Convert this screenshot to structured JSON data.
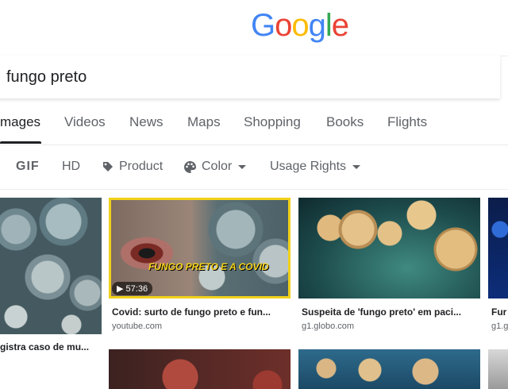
{
  "header": {
    "logo_letters": [
      {
        "ch": "G",
        "color": "#4285F4"
      },
      {
        "ch": "o",
        "color": "#EA4335"
      },
      {
        "ch": "o",
        "color": "#FBBC05"
      },
      {
        "ch": "g",
        "color": "#4285F4"
      },
      {
        "ch": "l",
        "color": "#34A853"
      },
      {
        "ch": "e",
        "color": "#EA4335"
      }
    ]
  },
  "search": {
    "value": "fungo preto"
  },
  "tabs": {
    "images": "mages",
    "videos": "Videos",
    "news": "News",
    "maps": "Maps",
    "shopping": "Shopping",
    "books": "Books",
    "flights": "Flights",
    "active": "images"
  },
  "filters": {
    "gif": "GIF",
    "hd": "HD",
    "product": "Product",
    "color": "Color",
    "usage_rights": "Usage Rights"
  },
  "results": [
    {
      "title": "gistra caso de mu...",
      "source": ""
    },
    {
      "title": "Covid: surto de fungo preto e fun...",
      "source": "youtube.com",
      "duration": "57:36",
      "overlay": "FUNGO PRETO E A COVID"
    },
    {
      "title": "Suspeita de 'fungo preto' em paci...",
      "source": "g1.globo.com"
    },
    {
      "title": "Fur",
      "source": "g1.g"
    }
  ],
  "colors": {
    "accent": "#202124",
    "muted": "#5f6368",
    "youtube_border": "#f1d11a"
  }
}
